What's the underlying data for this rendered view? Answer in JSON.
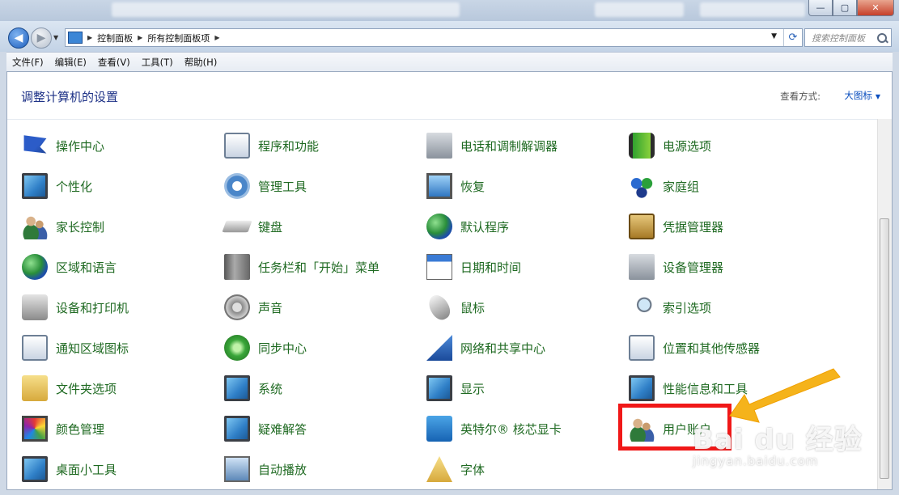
{
  "window": {
    "controls": {
      "minimize": "—",
      "maximize": "▢",
      "close": "✕"
    }
  },
  "address": {
    "crumbs": [
      "控制面板",
      "所有控制面板项"
    ],
    "search_placeholder": "搜索控制面板"
  },
  "menu": [
    "文件(F)",
    "编辑(E)",
    "查看(V)",
    "工具(T)",
    "帮助(H)"
  ],
  "page": {
    "title": "调整计算机的设置",
    "view_by_label": "查看方式:",
    "view_by_value": "大图标"
  },
  "columns": [
    [
      {
        "label": "操作中心",
        "icon": "action-center-flag-icon"
      },
      {
        "label": "个性化",
        "icon": "personalization-icon"
      },
      {
        "label": "家长控制",
        "icon": "parental-controls-icon"
      },
      {
        "label": "区域和语言",
        "icon": "region-language-icon"
      },
      {
        "label": "设备和打印机",
        "icon": "devices-printers-icon"
      },
      {
        "label": "通知区域图标",
        "icon": "notification-area-icon"
      },
      {
        "label": "文件夹选项",
        "icon": "folder-options-icon"
      },
      {
        "label": "颜色管理",
        "icon": "color-management-icon"
      },
      {
        "label": "桌面小工具",
        "icon": "desktop-gadgets-icon"
      }
    ],
    [
      {
        "label": "程序和功能",
        "icon": "programs-features-icon"
      },
      {
        "label": "管理工具",
        "icon": "admin-tools-icon"
      },
      {
        "label": "键盘",
        "icon": "keyboard-icon"
      },
      {
        "label": "任务栏和「开始」菜单",
        "icon": "taskbar-start-menu-icon"
      },
      {
        "label": "声音",
        "icon": "sound-icon"
      },
      {
        "label": "同步中心",
        "icon": "sync-center-icon"
      },
      {
        "label": "系统",
        "icon": "system-icon"
      },
      {
        "label": "疑难解答",
        "icon": "troubleshooting-icon"
      },
      {
        "label": "自动播放",
        "icon": "autoplay-icon"
      }
    ],
    [
      {
        "label": "电话和调制解调器",
        "icon": "phone-modem-icon"
      },
      {
        "label": "恢复",
        "icon": "recovery-icon"
      },
      {
        "label": "默认程序",
        "icon": "default-programs-icon"
      },
      {
        "label": "日期和时间",
        "icon": "date-time-icon"
      },
      {
        "label": "鼠标",
        "icon": "mouse-icon"
      },
      {
        "label": "网络和共享中心",
        "icon": "network-sharing-icon"
      },
      {
        "label": "显示",
        "icon": "display-icon"
      },
      {
        "label": "英特尔® 核芯显卡",
        "icon": "intel-graphics-icon"
      },
      {
        "label": "字体",
        "icon": "fonts-icon"
      }
    ],
    [
      {
        "label": "电源选项",
        "icon": "power-options-icon"
      },
      {
        "label": "家庭组",
        "icon": "homegroup-icon"
      },
      {
        "label": "凭据管理器",
        "icon": "credential-manager-icon"
      },
      {
        "label": "设备管理器",
        "icon": "device-manager-icon"
      },
      {
        "label": "索引选项",
        "icon": "indexing-options-icon"
      },
      {
        "label": "位置和其他传感器",
        "icon": "location-sensors-icon"
      },
      {
        "label": "性能信息和工具",
        "icon": "performance-info-icon"
      },
      {
        "label": "用户账户",
        "icon": "user-accounts-icon"
      }
    ]
  ],
  "watermark": {
    "main": "Bai du 经验",
    "sub": "jingyan.baidu.com"
  }
}
